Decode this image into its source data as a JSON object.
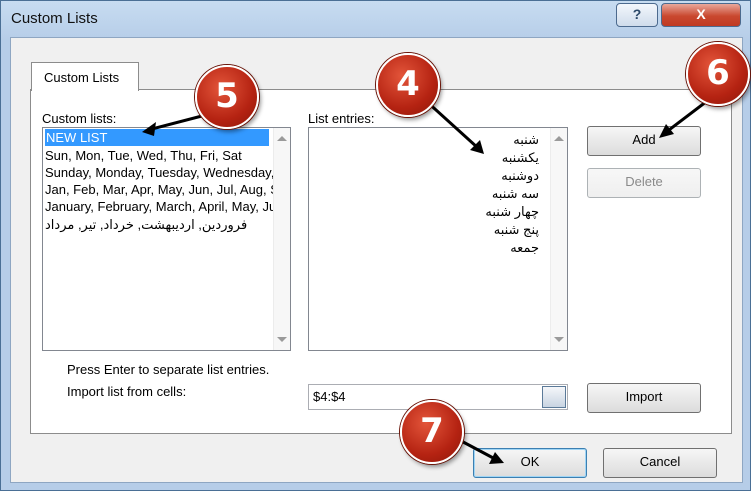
{
  "window": {
    "title": "Custom Lists",
    "help_glyph": "?",
    "close_glyph": "X"
  },
  "tab": {
    "label": "Custom Lists"
  },
  "custom_lists": {
    "label": "Custom lists:",
    "items": [
      "NEW LIST",
      "Sun, Mon, Tue, Wed, Thu, Fri, Sat",
      "Sunday, Monday, Tuesday, Wednesday, Thursday, Friday, Saturday",
      "Jan, Feb, Mar, Apr, May, Jun, Jul, Aug, Sep, Oct, Nov, Dec",
      "January, February, March, April, May, June, July",
      "فروردین, اردیبهشت, خرداد, تیر, مرداد"
    ]
  },
  "list_entries": {
    "label": "List entries:",
    "items": [
      "شنبه",
      "یکشنبه",
      "دوشنبه",
      "سه شنبه",
      "چهار شنبه",
      "پنج شنبه",
      "جمعه"
    ]
  },
  "buttons": {
    "add": "Add",
    "delete": "Delete",
    "import": "Import",
    "ok": "OK",
    "cancel": "Cancel"
  },
  "hint": "Press Enter to separate list entries.",
  "import": {
    "label": "Import list from cells:",
    "value": "$4:$4"
  },
  "callouts": {
    "c4": "4",
    "c5": "5",
    "c6": "6",
    "c7": "7"
  }
}
